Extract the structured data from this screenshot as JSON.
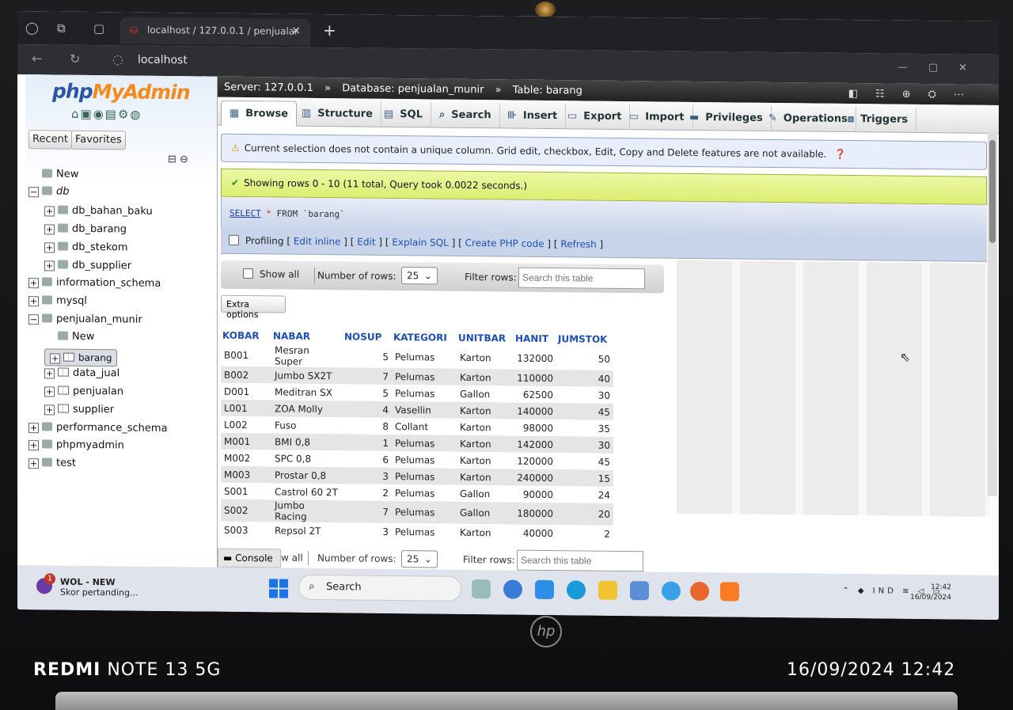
{
  "browser": {
    "tab_title": "localhost / 127.0.0.1 / penjualar",
    "url": "localhost"
  },
  "nav": {
    "logo_a": "php",
    "logo_b": "MyAdmin",
    "recent": "Recent",
    "favorites": "Favorites",
    "tree": [
      {
        "label": "New",
        "indent": 0
      },
      {
        "label": "db",
        "indent": 0
      },
      {
        "label": "db_bahan_baku",
        "indent": 1
      },
      {
        "label": "db_barang",
        "indent": 1
      },
      {
        "label": "db_stekom",
        "indent": 1
      },
      {
        "label": "db_supplier",
        "indent": 1
      },
      {
        "label": "information_schema",
        "indent": 0
      },
      {
        "label": "mysql",
        "indent": 0
      },
      {
        "label": "penjualan_munir",
        "indent": 0
      },
      {
        "label": "New",
        "indent": 1
      },
      {
        "label": "barang",
        "indent": 1
      },
      {
        "label": "data_jual",
        "indent": 1
      },
      {
        "label": "penjualan",
        "indent": 1
      },
      {
        "label": "supplier",
        "indent": 1
      },
      {
        "label": "performance_schema",
        "indent": 0
      },
      {
        "label": "phpmyadmin",
        "indent": 0
      },
      {
        "label": "test",
        "indent": 0
      }
    ]
  },
  "breadcrumb": {
    "server": "Server: 127.0.0.1",
    "database": "Database: penjualan_munir",
    "table": "Table: barang"
  },
  "tabs": [
    "Browse",
    "Structure",
    "SQL",
    "Search",
    "Insert",
    "Export",
    "Import",
    "Privileges",
    "Operations",
    "Triggers"
  ],
  "warning": "Current selection does not contain a unique column. Grid edit, checkbox, Edit, Copy and Delete features are not available.",
  "success": "Showing rows 0 - 10 (11 total, Query took 0.0022 seconds.)",
  "sql": {
    "kw1": "SELECT",
    "star": "*",
    "kw2": "FROM",
    "table": "`barang`"
  },
  "profiling": {
    "label": "Profiling",
    "edit_inline": "Edit inline",
    "edit": "Edit",
    "explain": "Explain SQL",
    "create_php": "Create PHP code",
    "refresh": "Refresh"
  },
  "controls": {
    "show_all": "Show all",
    "rows_label": "Number of rows:",
    "rows_value": "25",
    "filter_label": "Filter rows:",
    "filter_placeholder": "Search this table",
    "extra_options": "Extra options"
  },
  "table": {
    "columns": [
      "KOBAR",
      "NABAR",
      "NOSUP",
      "KATEGORI",
      "UNITBAR",
      "HANIT",
      "JUMSTOK"
    ],
    "rows": [
      [
        "B001",
        "Mesran Super",
        "5",
        "Pelumas",
        "Karton",
        "132000",
        "50"
      ],
      [
        "B002",
        "Jumbo SX2T",
        "7",
        "Pelumas",
        "Karton",
        "110000",
        "40"
      ],
      [
        "D001",
        "Meditran SX",
        "5",
        "Pelumas",
        "Gallon",
        "62500",
        "30"
      ],
      [
        "L001",
        "ZOA Molly",
        "4",
        "Vasellin",
        "Karton",
        "140000",
        "45"
      ],
      [
        "L002",
        "Fuso",
        "8",
        "Collant",
        "Karton",
        "98000",
        "35"
      ],
      [
        "M001",
        "BMI 0,8",
        "1",
        "Pelumas",
        "Karton",
        "142000",
        "30"
      ],
      [
        "M002",
        "SPC 0,8",
        "6",
        "Pelumas",
        "Karton",
        "120000",
        "45"
      ],
      [
        "M003",
        "Prostar 0,8",
        "3",
        "Pelumas",
        "Karton",
        "240000",
        "15"
      ],
      [
        "S001",
        "Castrol 60 2T",
        "2",
        "Pelumas",
        "Gallon",
        "90000",
        "24"
      ],
      [
        "S002",
        "Jumbo Racing",
        "7",
        "Pelumas",
        "Gallon",
        "180000",
        "20"
      ],
      [
        "S003",
        "Repsol 2T",
        "3",
        "Pelumas",
        "Karton",
        "40000",
        "2"
      ]
    ]
  },
  "bottom": {
    "console": "Console",
    "show_all_partial": "w all",
    "rows_label": "Number of rows:",
    "rows_value": "25",
    "filter_label": "Filter rows:",
    "filter_placeholder": "Search this table"
  },
  "taskbar": {
    "notif_title": "WOL - NEW",
    "notif_sub": "Skor pertanding...",
    "notif_badge": "1",
    "search": "Search",
    "lang": "IND",
    "time": "12:42",
    "date": "16/09/2024"
  },
  "device": {
    "brand_bold": "REDMI",
    "brand_rest": "NOTE 13 5G",
    "stamp": "16/09/2024  12:42",
    "laptop_logo": "hp"
  }
}
